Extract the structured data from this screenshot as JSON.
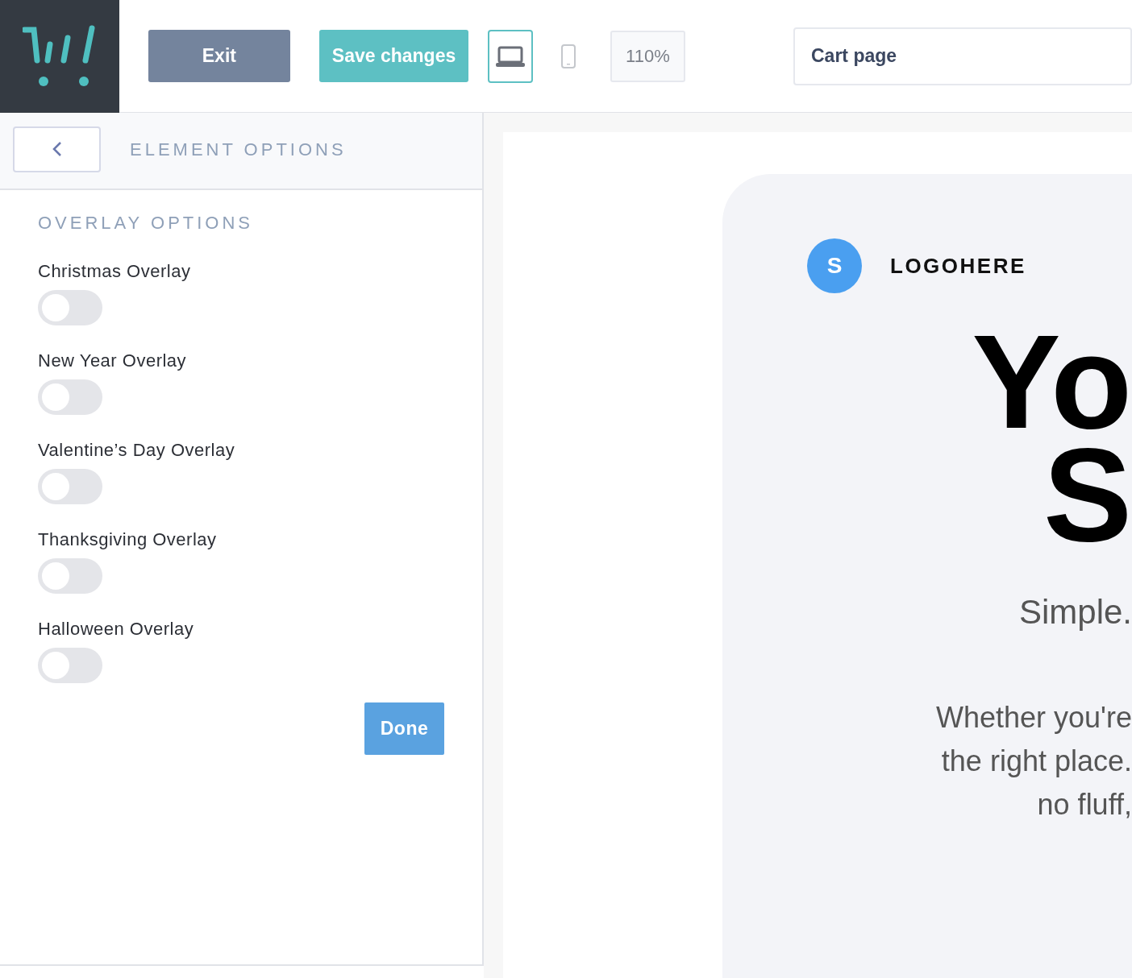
{
  "toolbar": {
    "exit": "Exit",
    "save": "Save changes",
    "devices": [
      {
        "kind": "desktop",
        "selected": true
      },
      {
        "kind": "mobile",
        "selected": false
      }
    ],
    "zoom": "110%",
    "page": "Cart page"
  },
  "sidebar": {
    "title": "ELEMENT OPTIONS",
    "section": "OVERLAY OPTIONS",
    "options": [
      {
        "label": "Christmas Overlay",
        "on": false
      },
      {
        "label": "New Year Overlay",
        "on": false
      },
      {
        "label": "Valentine’s Day Overlay",
        "on": false
      },
      {
        "label": "Thanksgiving Overlay",
        "on": false
      },
      {
        "label": "Halloween Overlay",
        "on": false
      }
    ],
    "done": "Done"
  },
  "preview": {
    "logo_letter": "S",
    "logo_text": "LOGOHERE",
    "headline": [
      "Yo",
      "S"
    ],
    "tagline": "Simple.",
    "body": [
      "Whether you're",
      "the right place.",
      "no fluff,"
    ]
  }
}
